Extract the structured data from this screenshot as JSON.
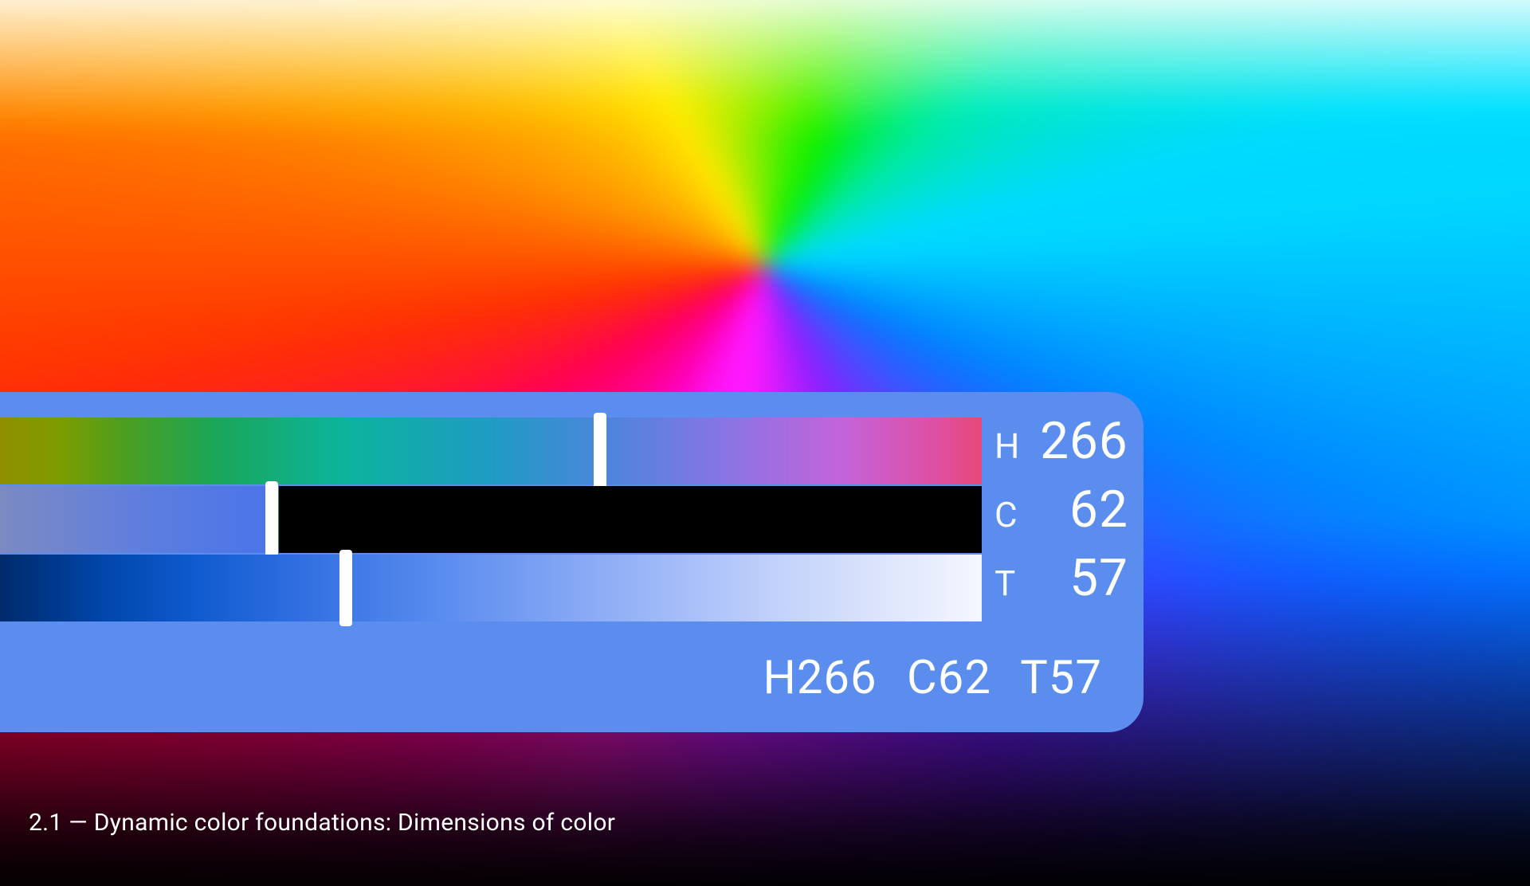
{
  "panel": {
    "accent_bg": "#5a8dee",
    "sliders": {
      "hue": {
        "key": "H",
        "value": 266
      },
      "chroma": {
        "key": "C",
        "value": 62
      },
      "tone": {
        "key": "T",
        "value": 57
      }
    },
    "summary": "H266  C62  T57"
  },
  "caption": "2.1 — Dynamic color foundations: Dimensions of color"
}
